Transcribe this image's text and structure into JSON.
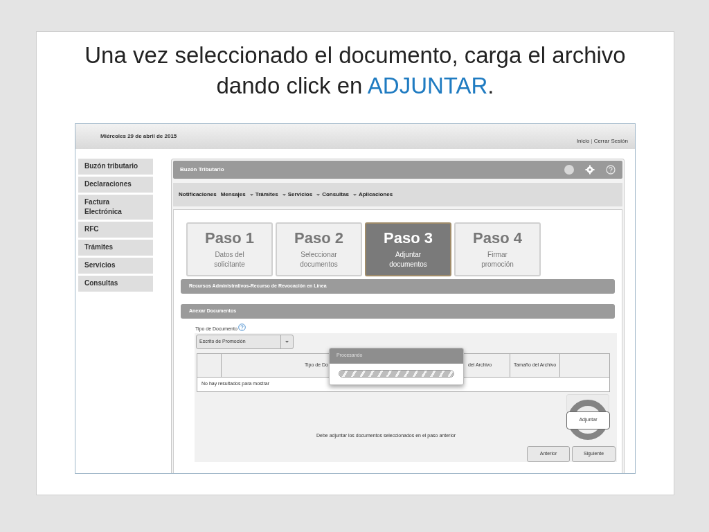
{
  "slide_title": [
    {
      "text": "Una vez seleccionado el documento, carga el archivo dando click en ",
      "kind": "plain"
    },
    {
      "text": "ADJUNTAR",
      "kind": "highlight"
    },
    {
      "text": ".",
      "kind": "plain"
    }
  ],
  "header": {
    "date": "Miércoles 29 de abril de 2015",
    "links": [
      "Inicio",
      "Cerrar Sesión"
    ],
    "separator": "|"
  },
  "sidebar": {
    "items": [
      {
        "label": "Buzón tributario"
      },
      {
        "label": "Declaraciones"
      },
      {
        "label": "Factura Electrónica"
      },
      {
        "label": "RFC"
      },
      {
        "label": "Trámites"
      },
      {
        "label": "Servicios"
      },
      {
        "label": "Consultas"
      }
    ]
  },
  "panel": {
    "title": "Buzón Tributario"
  },
  "menu": [
    {
      "label": "Notificaciones",
      "dropdown": false
    },
    {
      "label": "Mensajes",
      "dropdown": false
    },
    {
      "label": "Trámites",
      "dropdown": true
    },
    {
      "label": "Servicios",
      "dropdown": true
    },
    {
      "label": "Consultas",
      "dropdown": true
    },
    {
      "label": "Aplicaciones",
      "dropdown": true
    }
  ],
  "steps": [
    {
      "title": "Paso 1",
      "subtitle": "Datos del solicitante",
      "selected": false
    },
    {
      "title": "Paso 2",
      "subtitle": "Seleccionar documentos",
      "selected": false
    },
    {
      "title": "Paso 3",
      "subtitle": "Adjuntar documentos",
      "selected": true
    },
    {
      "title": "Paso 4",
      "subtitle": "Firmar promoción",
      "selected": false
    }
  ],
  "sections": [
    "Recursos Administrativos-Recurso de Revocación en Línea",
    "Anexar Documentos"
  ],
  "document_type": {
    "label": "Tipo de Documento",
    "value": "Escrito de Promoción"
  },
  "table": {
    "columns": [
      "",
      "Tipo de Do",
      "del Archivo",
      "Tamaño del Archivo",
      ""
    ],
    "empty_message": "No hay resultados para mostrar"
  },
  "dialog": {
    "title": "Procesando",
    "progress": {
      "level": 1
    }
  },
  "attach_button": "Adjuntar",
  "message": "Debe adjuntar los documentos seleccionados en el paso anterior",
  "nav_buttons": [
    "Anterior",
    "Siguiente"
  ]
}
